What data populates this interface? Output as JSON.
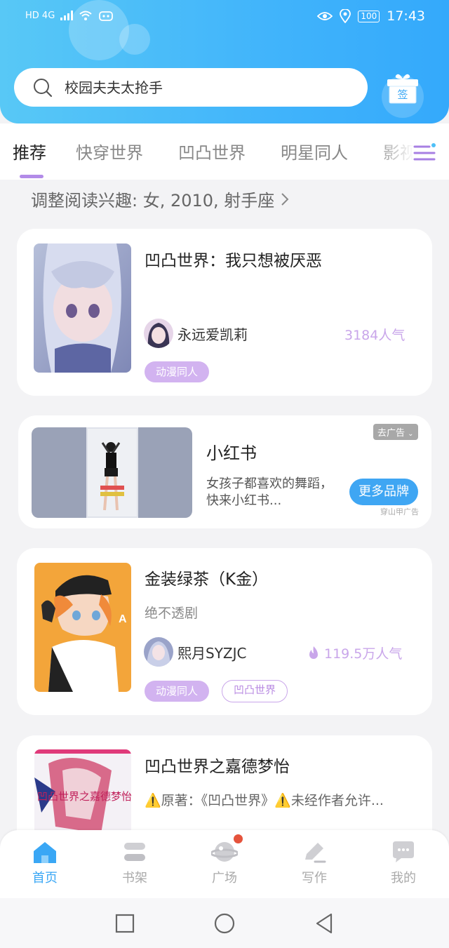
{
  "status_bar": {
    "network": "HD 4G",
    "battery": "100",
    "time": "17:43"
  },
  "search": {
    "placeholder": "校园夫夫太抢手"
  },
  "checkin": {
    "label": "签"
  },
  "tabs": [
    {
      "label": "推荐",
      "active": true
    },
    {
      "label": "快穿世界",
      "active": false
    },
    {
      "label": "凹凸世界",
      "active": false
    },
    {
      "label": "明星同人",
      "active": false
    },
    {
      "label": "影视",
      "active": false
    }
  ],
  "interest": {
    "text": "调整阅读兴趣: 女, 2010, 射手座"
  },
  "cards": [
    {
      "title": "凹凸世界：我只想被厌恶",
      "author": "永远爱凯莉",
      "popularity": "3184人气",
      "tags": [
        "动漫同人"
      ]
    },
    {
      "title": "金装绿茶（K金）",
      "description": "绝不透剧",
      "author": "熙月SYZJC",
      "popularity": "119.5万人气",
      "tags": [
        "动漫同人",
        "凹凸世界"
      ]
    },
    {
      "title": "凹凸世界之嘉德梦怡",
      "description": "⚠️原著：《凹凸世界》⚠️未经作者允许...",
      "cover_text": "凹凸世界之嘉德梦怡"
    }
  ],
  "ad": {
    "title": "小红书",
    "description": "女孩子都喜欢的舞蹈，快来小红书...",
    "close_label": "去广告",
    "button_label": "更多品牌",
    "source": "穿山甲广告"
  },
  "bottom_nav": [
    {
      "label": "首页",
      "icon": "home-icon",
      "active": true
    },
    {
      "label": "书架",
      "icon": "bookshelf-icon",
      "active": false
    },
    {
      "label": "广场",
      "icon": "planet-icon",
      "active": false
    },
    {
      "label": "写作",
      "icon": "pen-icon",
      "active": false
    },
    {
      "label": "我的",
      "icon": "chat-bubble-icon",
      "active": false
    }
  ],
  "colors": {
    "header": "#41b4fb",
    "accent_purple": "#b28be8",
    "tag_fill": "#d2b3f0",
    "nav_active": "#3aa7f5"
  }
}
